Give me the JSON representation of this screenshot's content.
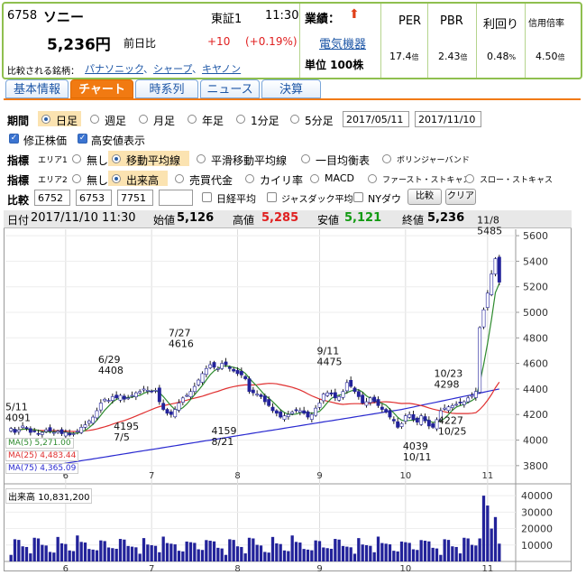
{
  "stock": {
    "code": "6758",
    "name": "ソニー",
    "market": "東証1",
    "time": "11:30",
    "price": "5,236円",
    "prev_label": "前日比",
    "change": "+10",
    "change_pct": "(+0.19%)",
    "performance_label": "業績：",
    "sector": "電気機器",
    "unit": "単位 100株",
    "compare_label": "比較される銘柄：",
    "compare_stocks": [
      "パナソニック",
      "シャープ",
      "キヤノン"
    ]
  },
  "metrics": [
    {
      "label": "PER",
      "value": "17.4",
      "unit": "倍"
    },
    {
      "label": "PBR",
      "value": "2.43",
      "unit": "倍"
    },
    {
      "label": "利回り",
      "value": "0.48",
      "unit": "%"
    },
    {
      "label": "信用倍率",
      "value": "4.50",
      "unit": "倍"
    }
  ],
  "tabs": [
    "基本情報",
    "チャート",
    "時系列",
    "ニュース",
    "決算"
  ],
  "controls": {
    "period_label": "期間",
    "periods": [
      "日足",
      "週足",
      "月足",
      "年足",
      "1分足",
      "5分足"
    ],
    "date_from": "2017/05/11",
    "date_to": "2017/11/10",
    "check1": "修正株価",
    "check2": "高安値表示",
    "ind_label": "指標",
    "area1": "エリア1",
    "area1_opts": [
      "無し",
      "移動平均線",
      "平滑移動平均線",
      "一目均衡表",
      "ボリンジャーバンド"
    ],
    "area2": "エリア2",
    "area2_opts": [
      "無し",
      "出来高",
      "売買代金",
      "カイリ率",
      "MACD",
      "ファースト・ストキャス",
      "スロー・ストキャス"
    ],
    "compare_label": "比較",
    "compare_codes": [
      "6752",
      "6753",
      "7751",
      ""
    ],
    "cmp_checks": [
      "日経平均",
      "ジャスダック平均",
      "NYダウ"
    ],
    "cmp_button": "比較",
    "clear_button": "クリア"
  },
  "info": {
    "date_label": "日付",
    "date": "2017/11/10 11:30",
    "open_label": "始値",
    "open": "5,126",
    "high_label": "高値",
    "high": "5,285",
    "low_label": "安値",
    "low": "5,121",
    "close_label": "終値",
    "close": "5,236"
  },
  "ma": [
    {
      "label": "MA(5)",
      "value": "5,271.00",
      "color": "#2e8b2e"
    },
    {
      "label": "MA(25)",
      "value": "4,483.44",
      "color": "#e03030"
    },
    {
      "label": "MA(75)",
      "value": "4,365.09",
      "color": "#2a2ad0"
    }
  ],
  "volume_label": "出来高",
  "volume_value": "10,831,200",
  "annotations": [
    {
      "date": "5/11",
      "value": "4091"
    },
    {
      "date": "6/29",
      "value": "4408"
    },
    {
      "date": "7/5",
      "value": "4195"
    },
    {
      "date": "7/27",
      "value": "4616"
    },
    {
      "date": "8/21",
      "value": "4159"
    },
    {
      "date": "9/11",
      "value": "4475"
    },
    {
      "date": "10/11",
      "value": "4039"
    },
    {
      "date": "10/23",
      "value": "4298"
    },
    {
      "date": "10/25",
      "value": "4227"
    },
    {
      "date": "11/8",
      "value": "5485"
    }
  ],
  "colors": {
    "up": "#ffffff",
    "down": "#22229a",
    "border": "#8fbf4f",
    "accent": "#f17a12",
    "price_red": "#e02020",
    "price_green": "#129a12"
  },
  "chart_data": {
    "type": "candlestick",
    "y_ticks": [
      3800,
      4000,
      4200,
      4400,
      4600,
      4800,
      5000,
      5200,
      5400,
      5600
    ],
    "ylim": [
      3700,
      5650
    ],
    "x_month_labels": [
      "6",
      "7",
      "8",
      "9",
      "10",
      "11"
    ],
    "volume_ticks": [
      10000,
      20000,
      30000,
      40000
    ],
    "volume_ylim": [
      0,
      45000
    ],
    "ohlc_close": [
      4091,
      4060,
      4080,
      4110,
      4090,
      4060,
      4070,
      4050,
      4060,
      4080,
      4070,
      4060,
      4070,
      4050,
      4060,
      4040,
      4050,
      4070,
      4100,
      4120,
      4150,
      4180,
      4230,
      4290,
      4320,
      4310,
      4340,
      4330,
      4350,
      4320,
      4330,
      4350,
      4370,
      4380,
      4400,
      4390,
      4380,
      4390,
      4300,
      4240,
      4210,
      4200,
      4240,
      4290,
      4330,
      4350,
      4380,
      4420,
      4470,
      4520,
      4560,
      4590,
      4570,
      4560,
      4600,
      4590,
      4560,
      4540,
      4520,
      4510,
      4480,
      4380,
      4370,
      4360,
      4340,
      4300,
      4270,
      4230,
      4210,
      4180,
      4190,
      4200,
      4220,
      4230,
      4230,
      4210,
      4180,
      4200,
      4250,
      4290,
      4360,
      4370,
      4360,
      4330,
      4340,
      4380,
      4450,
      4420,
      4380,
      4340,
      4290,
      4300,
      4330,
      4300,
      4270,
      4240,
      4220,
      4180,
      4150,
      4100,
      4130,
      4190,
      4200,
      4160,
      4140,
      4190,
      4150,
      4110,
      4100,
      4160,
      4230,
      4250,
      4260,
      4270,
      4280,
      4290,
      4300,
      4330,
      4350,
      4380,
      4880,
      5020,
      5150,
      5300,
      5420,
      5236
    ],
    "ma_note": "MA5 green, MA25 red, MA75 blue"
  }
}
